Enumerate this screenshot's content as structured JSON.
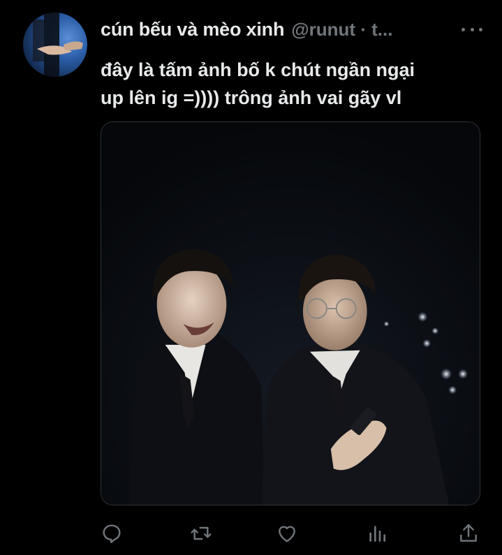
{
  "tweet": {
    "display_name": "cún bếu và mèo xinh",
    "handle": "@runut · t...",
    "text_lines": [
      "đây là tấm ảnh bố k chút ngần ngại",
      "up lên ig =)))) trông ảnh vai gãy vl"
    ]
  },
  "icons": {
    "more": "more-dots-icon",
    "reply": "reply-bubble-icon",
    "retweet": "retweet-icon",
    "like": "heart-icon",
    "views": "views-bar-chart-icon",
    "share": "share-upload-icon"
  },
  "colors": {
    "background": "#000000",
    "text_primary": "#e7e9ea",
    "text_secondary": "#71767b",
    "border": "#2f3336"
  }
}
